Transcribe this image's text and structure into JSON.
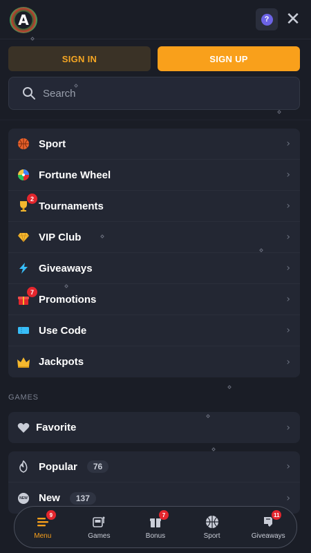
{
  "header": {
    "logo_glyph": "A",
    "help_glyph": "?",
    "close_glyph": "✕"
  },
  "auth": {
    "sign_in": "SIGN IN",
    "sign_up": "SIGN UP"
  },
  "search": {
    "placeholder": "Search",
    "value": ""
  },
  "menu": {
    "items": [
      {
        "label": "Sport",
        "icon": "basketball-icon",
        "badge": ""
      },
      {
        "label": "Fortune Wheel",
        "icon": "fortune-wheel-icon",
        "badge": ""
      },
      {
        "label": "Tournaments",
        "icon": "trophy-icon",
        "badge": "2"
      },
      {
        "label": "VIP Club",
        "icon": "diamond-icon",
        "badge": ""
      },
      {
        "label": "Giveaways",
        "icon": "lightning-icon",
        "badge": ""
      },
      {
        "label": "Promotions",
        "icon": "gift-icon",
        "badge": "7"
      },
      {
        "label": "Use Code",
        "icon": "ticket-icon",
        "badge": ""
      },
      {
        "label": "Jackpots",
        "icon": "crown-icon",
        "badge": ""
      }
    ]
  },
  "games": {
    "section_title": "GAMES",
    "favorite": {
      "label": "Favorite",
      "icon": "heart-icon"
    },
    "items": [
      {
        "label": "Popular",
        "count": "76",
        "icon": "flame-icon"
      },
      {
        "label": "New",
        "count": "137",
        "icon": "new-icon",
        "icon_text": "NEW"
      }
    ]
  },
  "bottom_nav": {
    "items": [
      {
        "label": "Menu",
        "badge": "9",
        "icon": "menu-icon",
        "active": true
      },
      {
        "label": "Games",
        "badge": "",
        "icon": "slot-machine-icon",
        "active": false
      },
      {
        "label": "Bonus",
        "badge": "7",
        "icon": "gift-icon",
        "active": false
      },
      {
        "label": "Sport",
        "badge": "",
        "icon": "basketball-icon",
        "active": false
      },
      {
        "label": "Giveaways",
        "badge": "11",
        "icon": "giveaway-icon",
        "active": false
      }
    ]
  },
  "colors": {
    "background": "#1a1d26",
    "card": "#232733",
    "accent_orange": "#f9a01b",
    "badge_red": "#e3262d",
    "help_purple": "#6c63e6"
  }
}
